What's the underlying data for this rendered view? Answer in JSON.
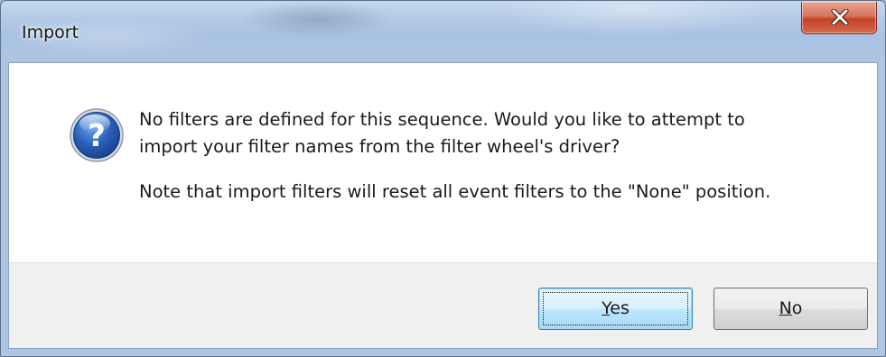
{
  "window": {
    "title": "Import"
  },
  "message": {
    "line1": "No filters are defined for this sequence.  Would you like to attempt to",
    "line2": "import your filter names from the filter wheel's driver?",
    "note": "Note that import filters will reset all event filters to the \"None\" position."
  },
  "buttons": {
    "yes_first": "Y",
    "yes_rest": "es",
    "no_first": "N",
    "no_rest": "o"
  },
  "icons": {
    "dialog": "question-icon",
    "close": "close-icon"
  },
  "colors": {
    "icon_blue": "#2a5fb8",
    "close_red": "#c2432a",
    "focus_blue": "#3c7fb1"
  }
}
